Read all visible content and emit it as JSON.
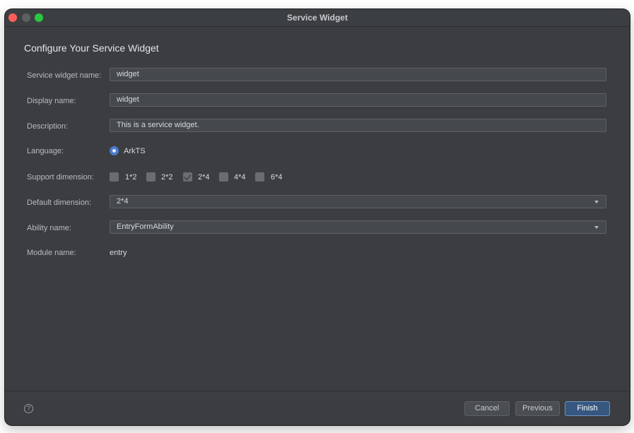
{
  "window": {
    "title": "Service Widget"
  },
  "form": {
    "heading": "Configure Your Service Widget",
    "service_widget_name": {
      "label": "Service widget name:",
      "value": "widget"
    },
    "display_name": {
      "label": "Display name:",
      "value": "widget"
    },
    "description": {
      "label": "Description:",
      "value": "This is a service widget."
    },
    "language": {
      "label": "Language:",
      "option": "ArkTS",
      "selected": true
    },
    "support_dimension": {
      "label": "Support dimension:",
      "options": [
        {
          "label": "1*2",
          "checked": false
        },
        {
          "label": "2*2",
          "checked": false
        },
        {
          "label": "2*4",
          "checked": true
        },
        {
          "label": "4*4",
          "checked": false
        },
        {
          "label": "6*4",
          "checked": false
        }
      ]
    },
    "default_dimension": {
      "label": "Default dimension:",
      "value": "2*4"
    },
    "ability_name": {
      "label": "Ability name:",
      "value": "EntryFormAbility"
    },
    "module_name": {
      "label": "Module name:",
      "value": "entry"
    }
  },
  "footer": {
    "help_symbol": "?",
    "cancel_label": "Cancel",
    "previous_label": "Previous",
    "finish_label": "Finish"
  },
  "colors": {
    "window_bg": "#3b3d40",
    "accent": "#4a7bd0",
    "primary_button": "#365880"
  }
}
